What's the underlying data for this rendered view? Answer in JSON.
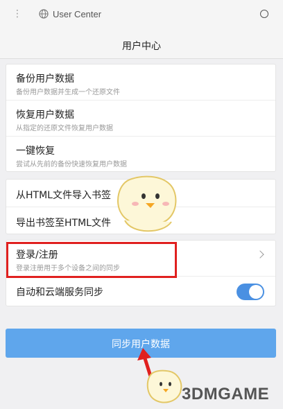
{
  "browser": {
    "menu_glyph": "⋮",
    "url": "User Center"
  },
  "header": {
    "title": "用户中心"
  },
  "backup_section": {
    "items": [
      {
        "title": "备份用户数据",
        "subtitle": "备份用户数据并生成一个还原文件"
      },
      {
        "title": "恢复用户数据",
        "subtitle": "从指定的还原文件恢复用户数据"
      },
      {
        "title": "一键恢复",
        "subtitle": "尝试从先前的备份快速恢复用户数据"
      }
    ]
  },
  "bookmark_section": {
    "items": [
      {
        "title": "从HTML文件导入书签"
      },
      {
        "title": "导出书签至HTML文件"
      }
    ]
  },
  "account_section": {
    "login": {
      "title": "登录/注册",
      "subtitle": "登录注册用于多个设备之间的同步"
    },
    "auto_sync": {
      "title": "自动和云端服务同步",
      "enabled": true
    }
  },
  "sync_button": {
    "label": "同步用户数据"
  },
  "watermark": {
    "text": "3DMGAME"
  },
  "colors": {
    "accent": "#5fa6ec",
    "toggle": "#4a90e2",
    "highlight": "#e0201f"
  }
}
